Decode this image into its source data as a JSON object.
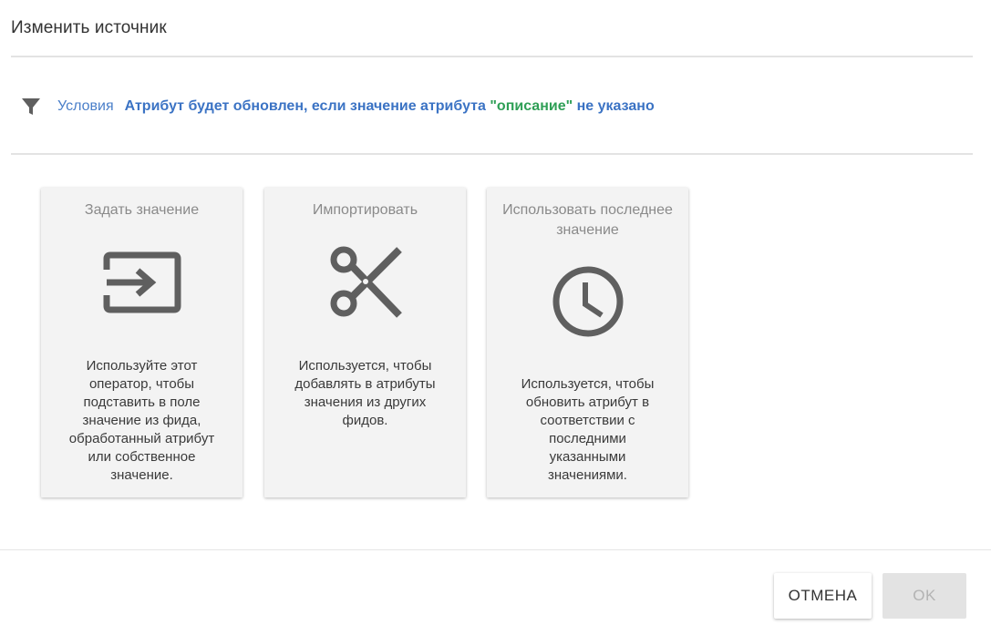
{
  "dialog": {
    "title": "Изменить источник"
  },
  "conditions": {
    "icon": "filter-icon",
    "label": "Условия",
    "text_before": "Атрибут будет обновлен, если значение атрибута ",
    "attribute": "\"описание\"",
    "text_after": " не указано"
  },
  "cards": [
    {
      "title": "Задать значение",
      "icon": "input-arrow-icon",
      "description": "Используйте этот оператор, чтобы подставить в поле значение из фида, обработанный атрибут или собственное значение."
    },
    {
      "title": "Импортировать",
      "icon": "scissors-icon",
      "description": "Используется, чтобы добавлять в атрибуты значения из других фидов."
    },
    {
      "title": "Использовать последнее значение",
      "icon": "clock-icon",
      "description": "Используется, чтобы обновить атрибут в соответствии с последними указанными значениями."
    }
  ],
  "footer": {
    "cancel_label": "ОТМЕНА",
    "ok_label": "OK"
  },
  "colors": {
    "link_blue": "#3b73c4",
    "attribute_green": "#2f9f56",
    "card_bg": "#f3f3f3",
    "icon_gray": "#5f5f5f"
  }
}
